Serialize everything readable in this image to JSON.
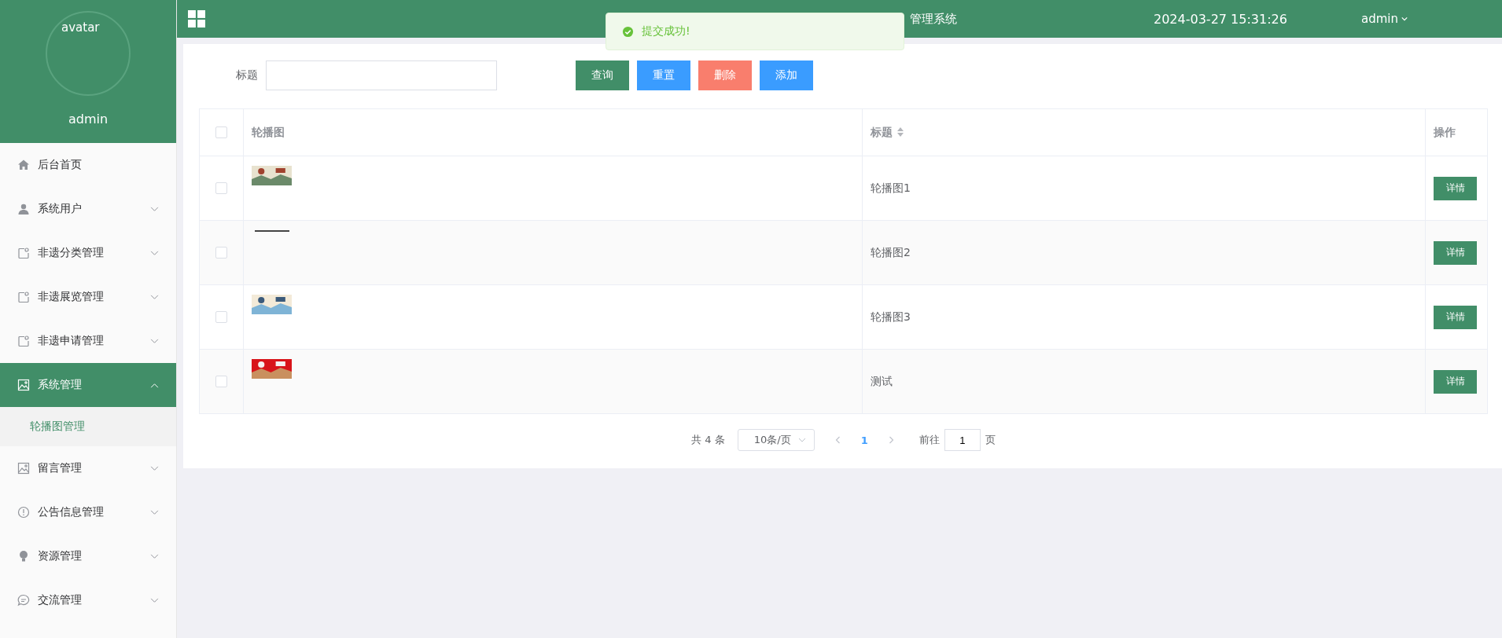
{
  "sidebar": {
    "avatar": {
      "alt": "avatar"
    },
    "username": "admin",
    "items": [
      {
        "label": "后台首页",
        "selected": false
      },
      {
        "label": "系统用户",
        "expandable": true,
        "expanded": false,
        "selected": false
      },
      {
        "label": "非遗分类管理",
        "expandable": true,
        "expanded": false,
        "selected": false
      },
      {
        "label": "非遗展览管理",
        "expandable": true,
        "expanded": false,
        "selected": false
      },
      {
        "label": "非遗申请管理",
        "expandable": true,
        "expanded": false,
        "selected": false
      },
      {
        "label": "系统管理",
        "expandable": true,
        "expanded": true,
        "selected": true,
        "children": [
          {
            "label": "轮播图管理",
            "selected": true
          }
        ]
      },
      {
        "label": "留言管理",
        "expandable": true,
        "expanded": false,
        "selected": false
      },
      {
        "label": "公告信息管理",
        "expandable": true,
        "expanded": false,
        "selected": false
      },
      {
        "label": "资源管理",
        "expandable": true,
        "expanded": false,
        "selected": false
      },
      {
        "label": "交流管理",
        "expandable": true,
        "expanded": false,
        "selected": false
      }
    ]
  },
  "header": {
    "title": "管理系统",
    "datetime": "2024-03-27 15:31:26",
    "user": "admin"
  },
  "toast": {
    "message": "提交成功!"
  },
  "search": {
    "label": "标题"
  },
  "buttons": [
    {
      "label": "查询",
      "kind": "primary"
    },
    {
      "label": "重置",
      "kind": "info"
    },
    {
      "label": "删除",
      "kind": "danger"
    },
    {
      "label": "添加",
      "kind": "info"
    }
  ],
  "table": {
    "all_checked": false,
    "columns": [
      {
        "label": "轮播图",
        "sortable": false
      },
      {
        "label": "标题",
        "sortable": true
      },
      {
        "label": "操作",
        "sortable": false
      }
    ],
    "rows": [
      {
        "checked": false,
        "title": "轮播图1",
        "action": "详情"
      },
      {
        "checked": false,
        "title": "轮播图2",
        "action": "详情"
      },
      {
        "checked": false,
        "title": "轮播图3",
        "action": "详情"
      },
      {
        "checked": false,
        "title": "测试",
        "action": "详情"
      }
    ]
  },
  "pagination": {
    "total": "共 4 条",
    "page_size": "10条/页",
    "pages": [
      {
        "label": "1",
        "selected": true
      }
    ],
    "goto_label": "前往",
    "goto_value": "1",
    "goto_suffix": "页"
  }
}
